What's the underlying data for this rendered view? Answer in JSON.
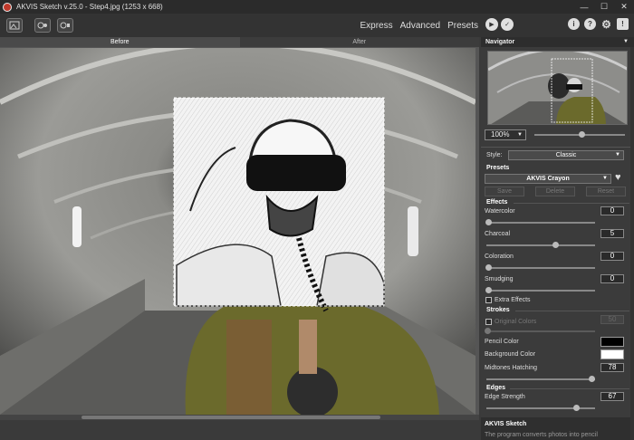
{
  "titlebar": {
    "title": "AKVIS Sketch v.25.0 - Step4.jpg (1253 x 668)",
    "minimize": "—",
    "maximize": "☐",
    "close": "✕"
  },
  "toolbar": {
    "modes": [
      "Express",
      "Advanced",
      "Presets"
    ],
    "help_icons": [
      "i",
      "?",
      "⚙",
      "!"
    ]
  },
  "view_tabs": [
    "Before",
    "After"
  ],
  "navigator": {
    "title": "Navigator",
    "zoom": "100%"
  },
  "settings": {
    "style_label": "Style:",
    "style_value": "Classic",
    "presets_label": "Presets",
    "preset_value": "AKVIS Crayon",
    "save_label": "Save",
    "delete_label": "Delete",
    "reset_label": "Reset",
    "effects_title": "Effects",
    "watercolor": {
      "label": "Watercolor",
      "value": "0"
    },
    "charcoal": {
      "label": "Charcoal",
      "value": "5"
    },
    "coloration": {
      "label": "Coloration",
      "value": "0"
    },
    "smudging": {
      "label": "Smudging",
      "value": "0"
    },
    "extra_effects": "Extra Effects",
    "strokes_title": "Strokes",
    "original_colors": {
      "label": "Original Colors",
      "value": "50"
    },
    "pencil_color": "Pencil Color",
    "background_color": "Background Color",
    "midtones_hatching": {
      "label": "Midtones Hatching",
      "value": "78"
    },
    "edges_title": "Edges",
    "edge_strength": {
      "label": "Edge Strength",
      "value": "67"
    },
    "about_title": "AKVIS Sketch",
    "about_text": "The program converts photos into pencil"
  },
  "colors": {
    "pencil": "#000000",
    "background": "#ffffff",
    "accent": "#c0392b"
  }
}
